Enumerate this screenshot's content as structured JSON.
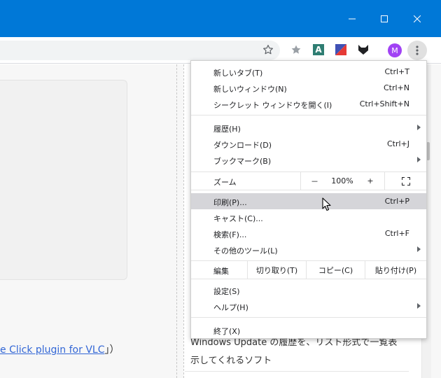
{
  "toolbar": {
    "avatar_letter": "M",
    "ext_a_letter": "A"
  },
  "menu": {
    "group1": [
      {
        "label": "新しいタブ(T)",
        "shortcut": "Ctrl+T"
      },
      {
        "label": "新しいウィンドウ(N)",
        "shortcut": "Ctrl+N"
      },
      {
        "label": "シークレット ウィンドウを開く(I)",
        "shortcut": "Ctrl+Shift+N"
      }
    ],
    "group2": [
      {
        "label": "履歴(H)",
        "shortcut": ""
      },
      {
        "label": "ダウンロード(D)",
        "shortcut": "Ctrl+J"
      },
      {
        "label": "ブックマーク(B)",
        "shortcut": ""
      }
    ],
    "zoom": {
      "label": "ズーム",
      "minus": "－",
      "value": "100%",
      "plus": "+"
    },
    "group3": [
      {
        "label": "印刷(P)...",
        "shortcut": "Ctrl+P"
      },
      {
        "label": "キャスト(C)...",
        "shortcut": ""
      },
      {
        "label": "検索(F)...",
        "shortcut": "Ctrl+F"
      },
      {
        "label": "その他のツール(L)",
        "shortcut": ""
      }
    ],
    "edit": {
      "label": "編集",
      "cut": "切り取り(T)",
      "copy": "コピー(C)",
      "paste": "貼り付け(P)"
    },
    "group4": [
      {
        "label": "設定(S)"
      },
      {
        "label": "ヘルプ(H)"
      }
    ],
    "exit": {
      "label": "終了(X)"
    }
  },
  "page": {
    "link_text": "e Click plugin for VLC",
    "link_suffix": "」）",
    "line1": "Windows Update の履歴を、リスト形式で一覧表",
    "line2": "示してくれるソフト"
  }
}
